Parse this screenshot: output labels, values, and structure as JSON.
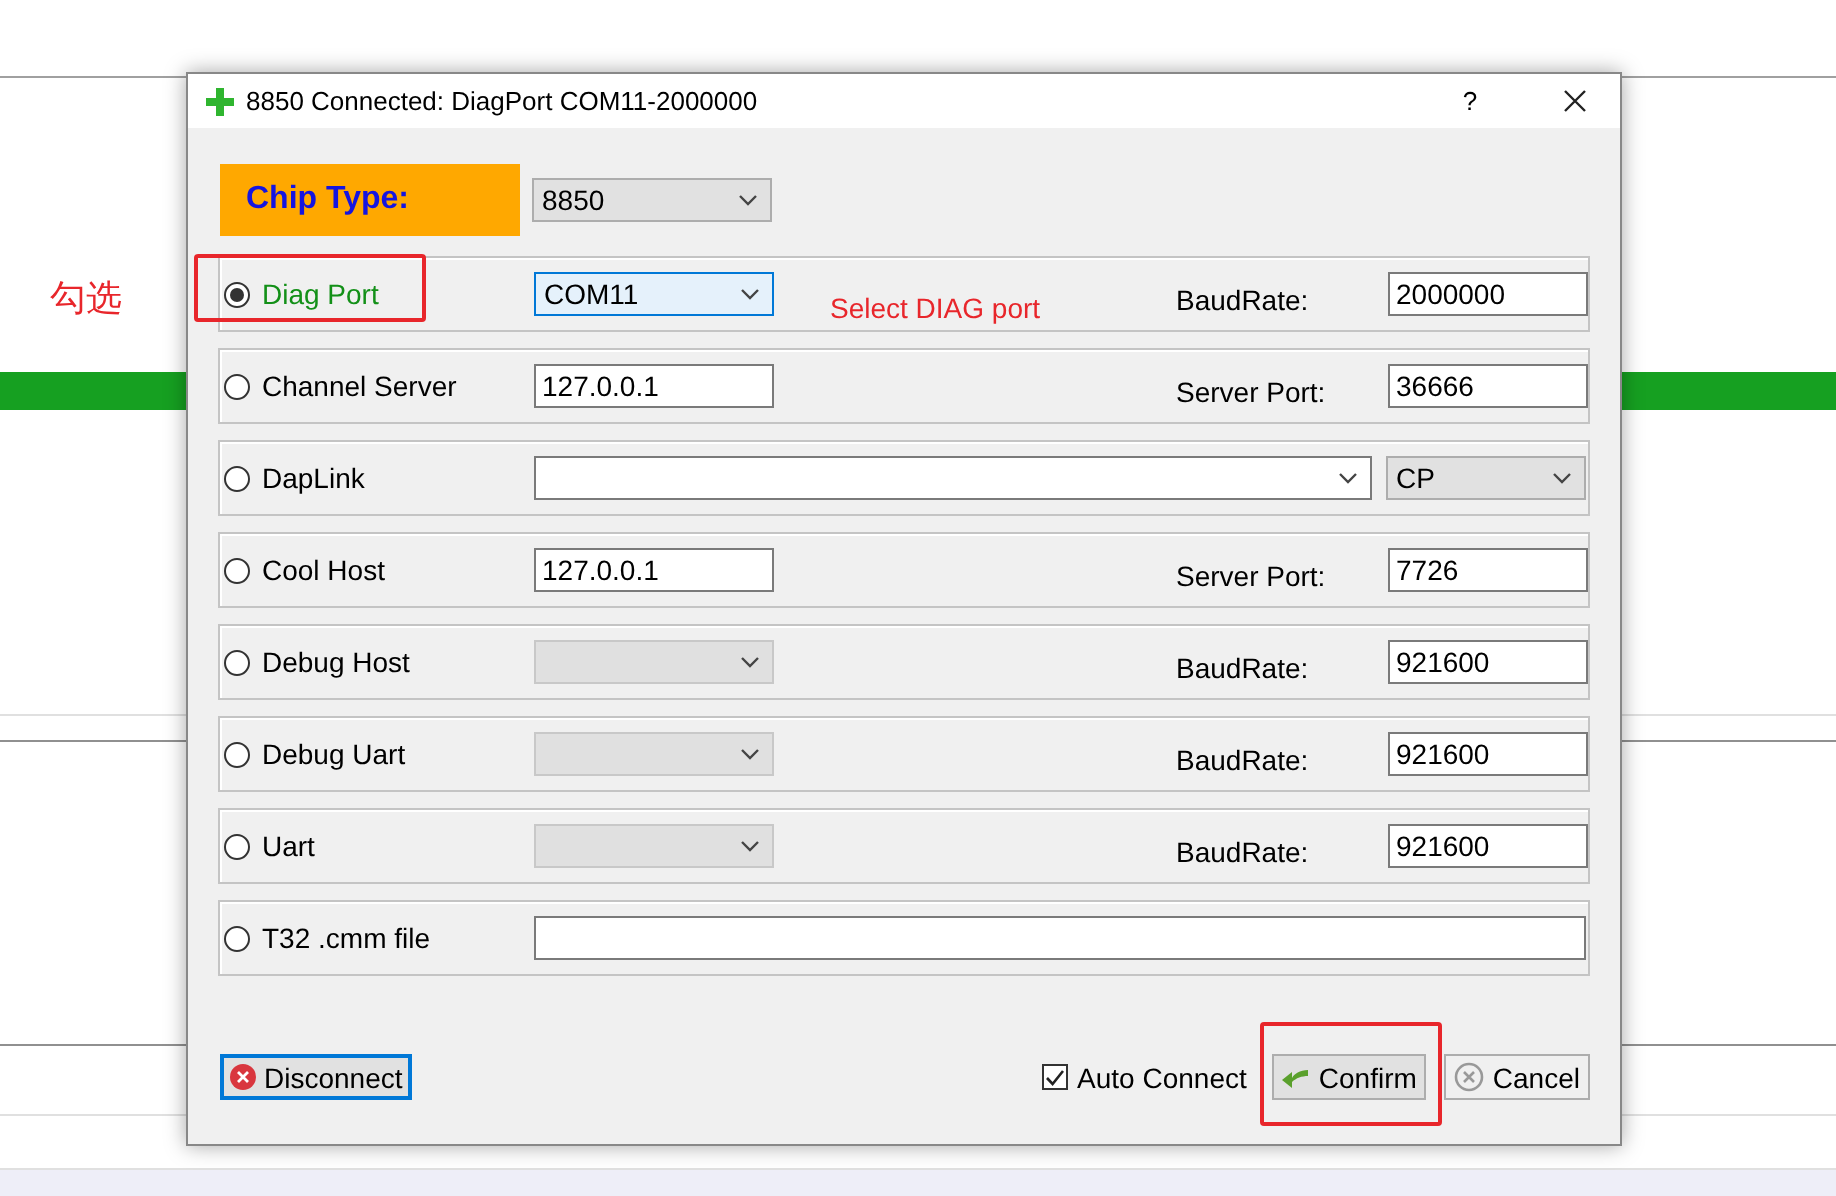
{
  "window": {
    "title": "8850 Connected: DiagPort COM11-2000000",
    "help": "?"
  },
  "chip_type": {
    "label": "Chip Type:",
    "value": "8850"
  },
  "connections": [
    {
      "label": "Diag Port",
      "selected": true,
      "marked": true,
      "control": {
        "kind": "select",
        "value": "COM11",
        "highlighted": true
      },
      "right": {
        "label": "BaudRate:",
        "value": "2000000"
      }
    },
    {
      "label": "Channel Server",
      "selected": false,
      "marked": false,
      "control": {
        "kind": "input",
        "value": "127.0.0.1"
      },
      "right": {
        "label": "Server Port:",
        "value": "36666"
      }
    },
    {
      "label": "DapLink",
      "selected": false,
      "marked": false,
      "control": {
        "kind": "combo"
      },
      "extra": {
        "value": "CP"
      }
    },
    {
      "label": "Cool Host",
      "selected": false,
      "marked": false,
      "control": {
        "kind": "input",
        "value": "127.0.0.1"
      },
      "right": {
        "label": "Server Port:",
        "value": "7726"
      }
    },
    {
      "label": "Debug Host",
      "selected": false,
      "marked": false,
      "control": {
        "kind": "select",
        "disabled": true
      },
      "right": {
        "label": "BaudRate:",
        "value": "921600"
      }
    },
    {
      "label": "Debug Uart",
      "selected": false,
      "marked": false,
      "control": {
        "kind": "select",
        "disabled": true
      },
      "right": {
        "label": "BaudRate:",
        "value": "921600"
      }
    },
    {
      "label": "Uart",
      "selected": false,
      "marked": false,
      "control": {
        "kind": "select",
        "disabled": true
      },
      "right": {
        "label": "BaudRate:",
        "value": "921600"
      }
    },
    {
      "label": "T32 .cmm file",
      "selected": false,
      "marked": false,
      "control": {
        "kind": "wide-input"
      }
    }
  ],
  "annotations": {
    "note": "勾选",
    "hint": "Select DIAG port"
  },
  "footer": {
    "disconnect": {
      "label": "Disconnect",
      "focused": true
    },
    "auto_connect": {
      "label": "Auto Connect",
      "checked": true
    },
    "confirm": {
      "label": "Confirm",
      "marked": true
    },
    "cancel": {
      "label": "Cancel"
    }
  }
}
